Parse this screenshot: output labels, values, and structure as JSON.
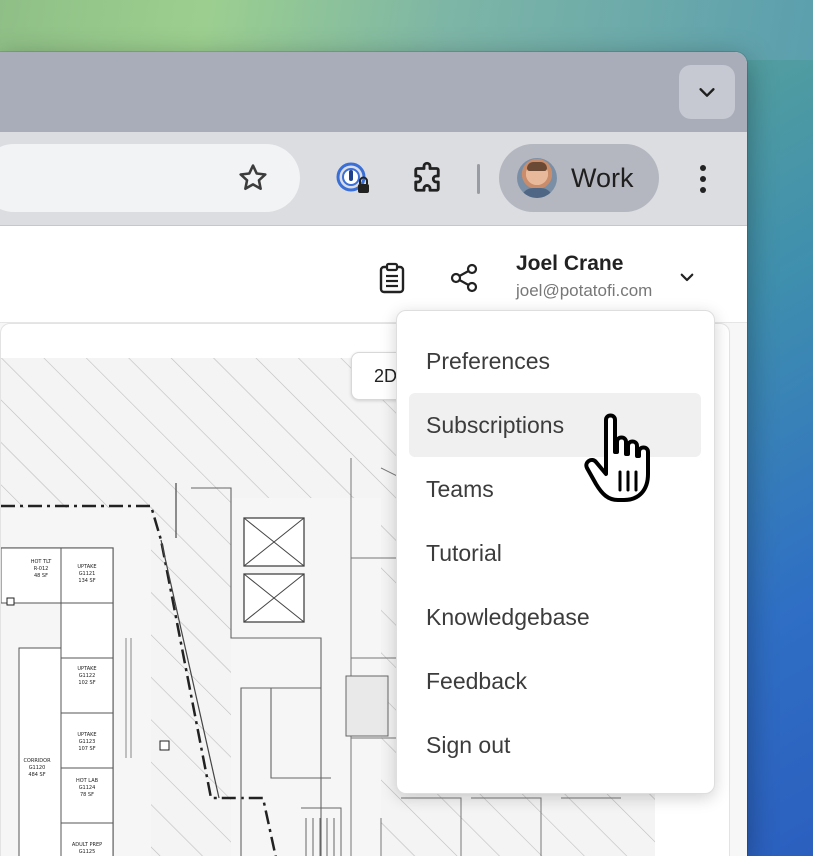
{
  "browser": {
    "profile_label": "Work"
  },
  "header": {
    "user_name": "Joel Crane",
    "user_email": "joel@potatofi.com"
  },
  "viewer": {
    "view_toggle_label": "2D"
  },
  "user_menu": {
    "items": [
      {
        "label": "Preferences",
        "active": false
      },
      {
        "label": "Subscriptions",
        "active": true
      },
      {
        "label": "Teams",
        "active": false
      },
      {
        "label": "Tutorial",
        "active": false
      },
      {
        "label": "Knowledgebase",
        "active": false
      },
      {
        "label": "Feedback",
        "active": false
      },
      {
        "label": "Sign out",
        "active": false
      }
    ]
  },
  "floorplan_labels": {
    "room1": "HOT TLT",
    "room1_no": "R-012",
    "room1_sf": "48 SF",
    "room2": "UPTAKE",
    "room2_no": "G1121",
    "room2_sf": "134 SF",
    "room3": "UPTAKE",
    "room3_no": "G1122",
    "room3_sf": "102 SF",
    "room4": "UPTAKE",
    "room4_no": "G1123",
    "room4_sf": "107 SF",
    "room5": "HOT LAB",
    "room5_no": "G1124",
    "room5_sf": "78 SF",
    "room6": "CORRIDOR",
    "room6_no": "G1120",
    "room6_sf": "484 SF",
    "room7": "ADULT PREP",
    "room7_no": "G1125"
  },
  "colors": {
    "tabstrip": "#a9adb9",
    "toolbar": "#dcdde1",
    "profile_chip": "#b4b7c0",
    "menu_active": "#f0f0f0"
  }
}
